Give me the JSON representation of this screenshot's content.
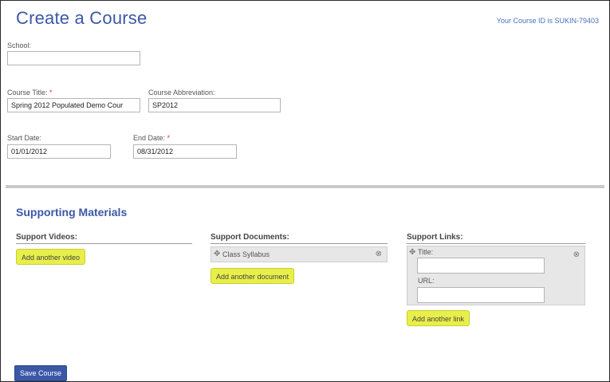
{
  "page": {
    "title": "Create a Course",
    "course_id_text": "Your Course ID is SUKIN-79403"
  },
  "form": {
    "school": {
      "label": "School:",
      "value": ""
    },
    "course_title": {
      "label": "Course Title:",
      "required_mark": "*",
      "value": "Spring 2012 Populated Demo Cour"
    },
    "course_abbreviation": {
      "label": "Course Abbreviation:",
      "value": "SP2012"
    },
    "start_date": {
      "label": "Start Date:",
      "value": "01/01/2012"
    },
    "end_date": {
      "label": "End Date:",
      "required_mark": "*",
      "value": "08/31/2012"
    }
  },
  "supporting": {
    "title": "Supporting Materials",
    "videos": {
      "heading": "Support Videos:",
      "add_button": "Add another video"
    },
    "documents": {
      "heading": "Support Documents:",
      "items": [
        {
          "label": "Class Syllabus"
        }
      ],
      "add_button": "Add another document"
    },
    "links": {
      "heading": "Support Links:",
      "title_label": "Title:",
      "url_label": "URL:",
      "title_value": "",
      "url_value": "",
      "add_button": "Add another link"
    }
  },
  "footer": {
    "save_button": "Save Course"
  },
  "icons": {
    "drag_handle": "move-icon",
    "remove": "remove-icon"
  },
  "colors": {
    "brand_blue": "#3b58a8",
    "highlight_yellow": "#e9ef4a",
    "required_red": "#dd3333"
  }
}
